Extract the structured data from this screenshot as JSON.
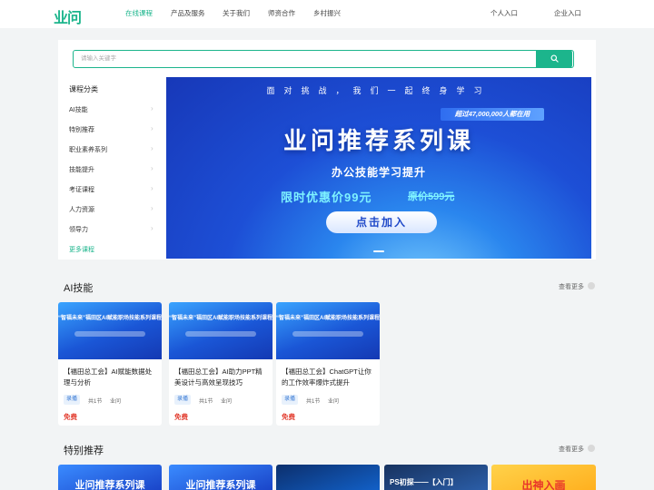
{
  "header": {
    "logo": "业问",
    "nav": [
      "在线课程",
      "产品及服务",
      "关于我们",
      "师资合作",
      "乡村振兴"
    ],
    "personal": "个人入口",
    "enterprise": "企业入口"
  },
  "search": {
    "placeholder": "请输入关键字"
  },
  "categories": {
    "title": "课程分类",
    "items": [
      "AI技能",
      "特别推荐",
      "职业素养系列",
      "技能提升",
      "考证课程",
      "人力资源",
      "领导力"
    ],
    "more": "更多课程"
  },
  "banner": {
    "top": "面对挑战，我们一起终身学习",
    "tag": "超过47,000,000人都在用",
    "title": "业问推荐系列课",
    "subtitle": "办公技能学习提升",
    "price": "限时优惠价99元",
    "original": "原价599元",
    "button": "点击加入"
  },
  "ai_section": {
    "title": "AI技能",
    "more": "查看更多",
    "cards": [
      {
        "img_head": "“智福未来”福田区AI赋能职场技能系列课程",
        "title": "【福田总工会】AI赋能数据处理与分析",
        "tag": "录播",
        "lessons": "共1节",
        "org": "业问",
        "price": "免费"
      },
      {
        "img_head": "“智福未来”福田区AI赋能职场技能系列课程",
        "title": "【福田总工会】AI助力PPT精美设计与高效呈现技巧",
        "tag": "录播",
        "lessons": "共1节",
        "org": "业问",
        "price": "免费"
      },
      {
        "img_head": "“智福未来”福田区AI赋能职场技能系列课程",
        "title": "【福田总工会】ChatGPT让你的工作效率爆炸式提升",
        "tag": "录播",
        "lessons": "共1节",
        "org": "业问",
        "price": "免费"
      }
    ]
  },
  "special_section": {
    "title": "特别推荐",
    "more": "查看更多",
    "cards": [
      {
        "text": "业问推荐系列课"
      },
      {
        "text": "业问推荐系列课"
      },
      {
        "text": ""
      },
      {
        "text": "PS初探——【入门】"
      },
      {
        "text": "出神入画"
      }
    ]
  },
  "colors": {
    "brand": "#1cb58c",
    "price": "#e23c2e",
    "banner": "#1d4fd6"
  }
}
